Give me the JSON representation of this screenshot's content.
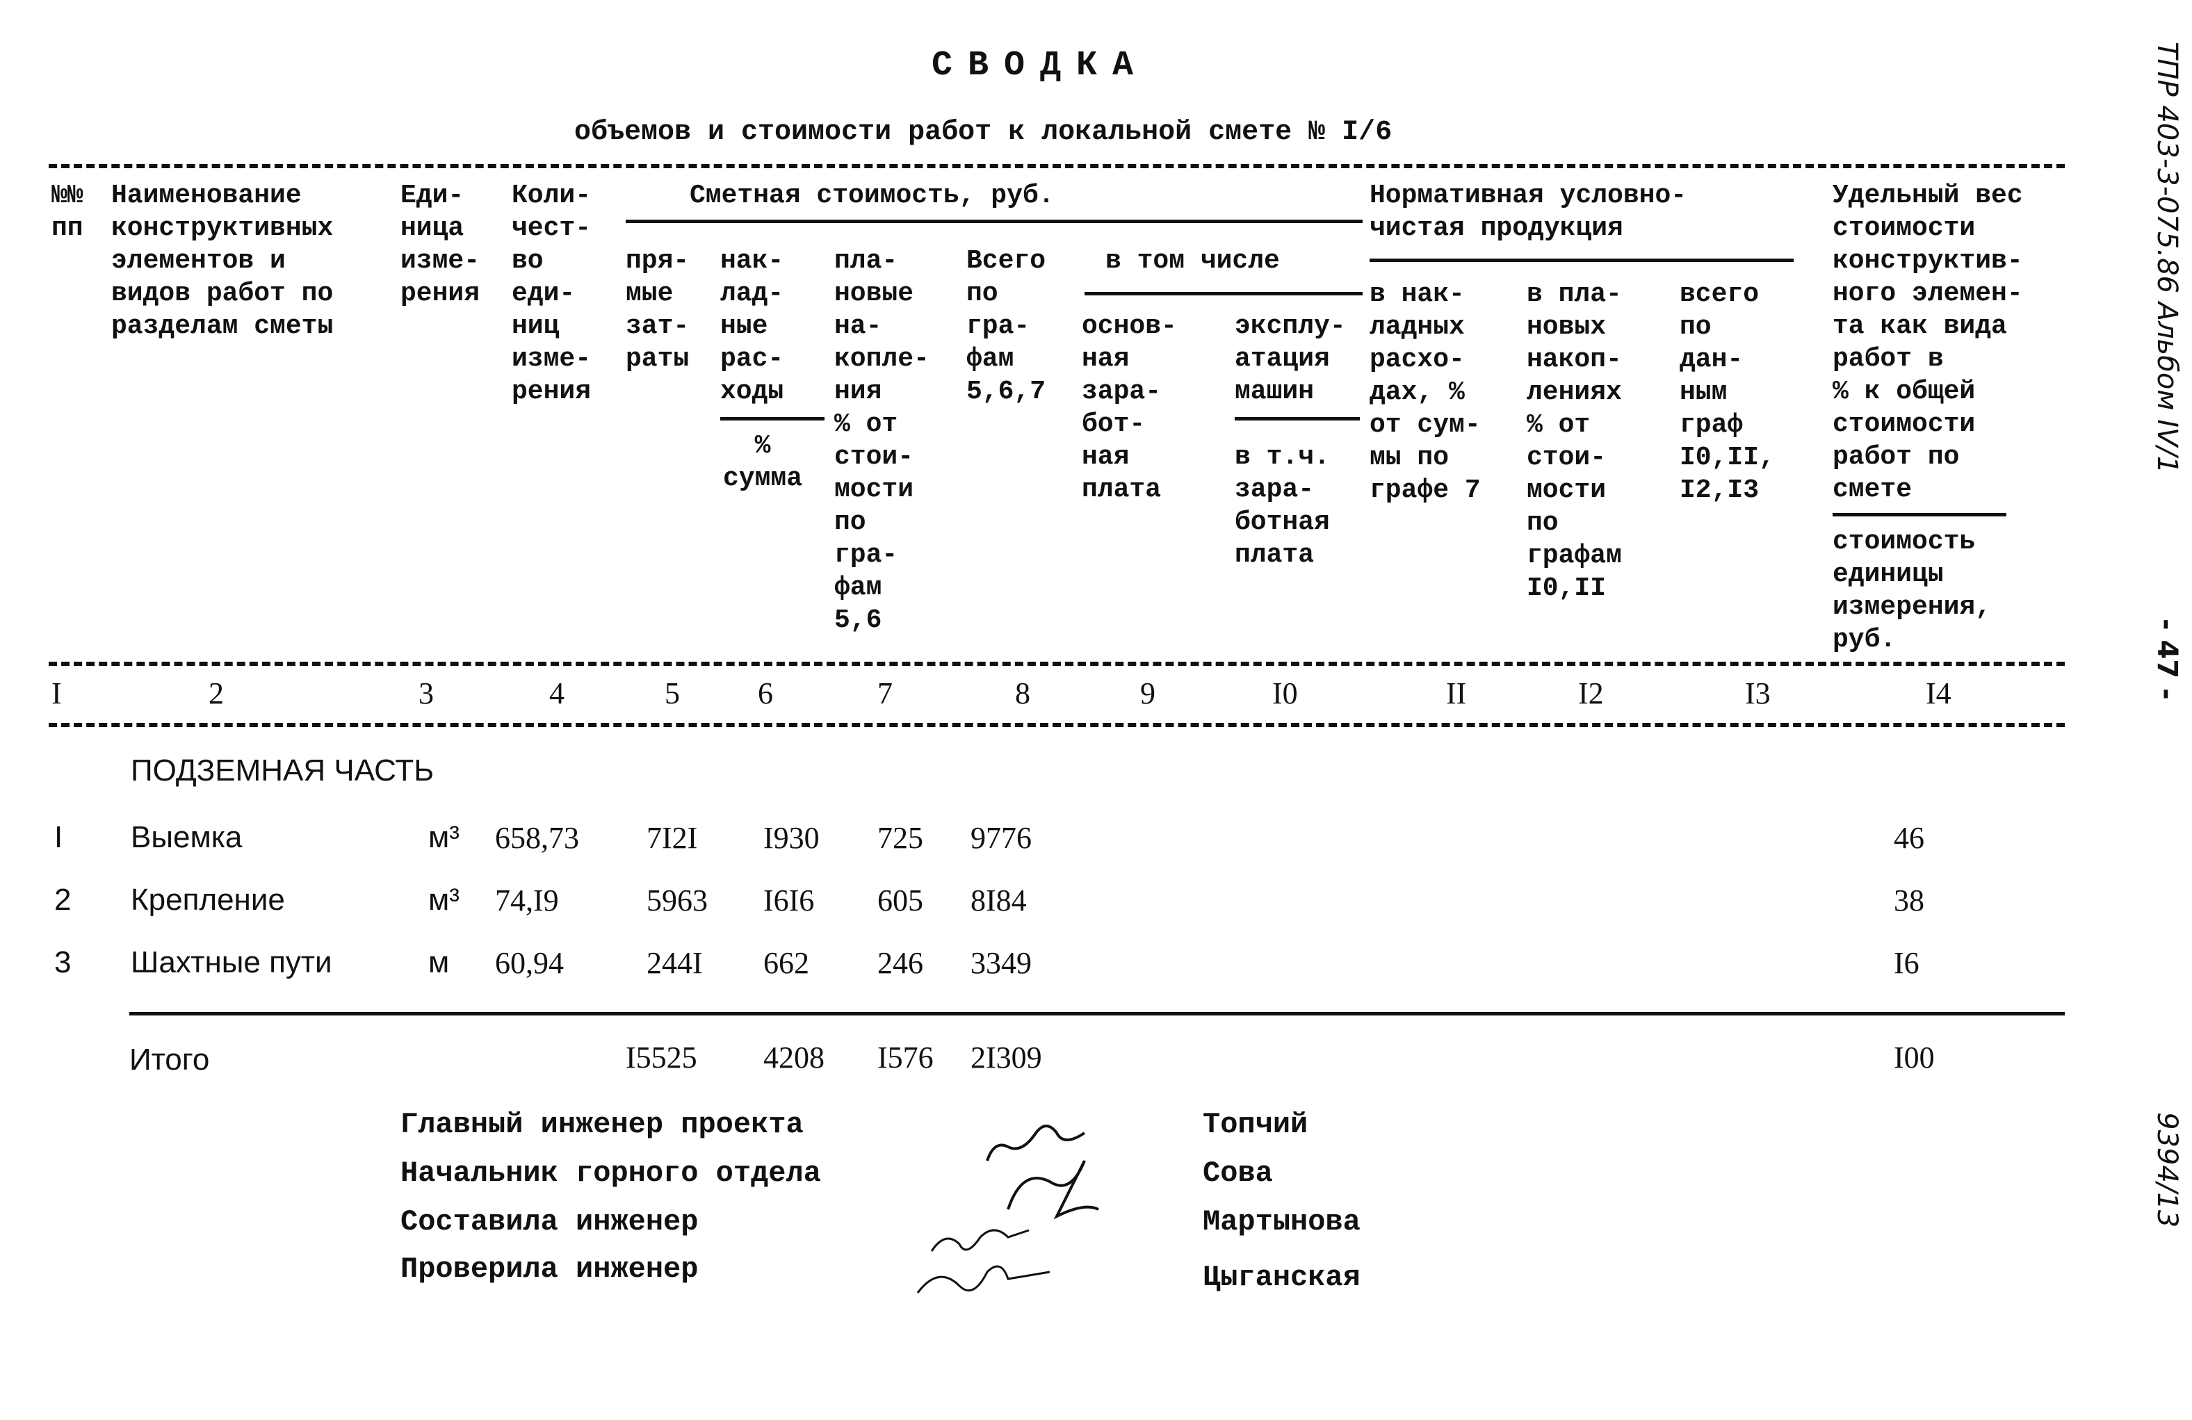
{
  "document": {
    "title": "СВОДКА",
    "subtitle": "объемов и стоимости работ к локальной смете № I/6",
    "margin_code": "ТПР 403-3-075.86 Альбом IV/1",
    "page_number": "- 47 -",
    "archive_number": "9394/13"
  },
  "table": {
    "headers": {
      "col1": "№№\nпп",
      "col2": "Наименование\nконструктивных\nэлементов и\nвидов работ по\nразделам сметы",
      "col3": "Еди-\nница\nизме-\nрения",
      "col4": "Коли-\nчест-\nво\nеди-\nниц\nизме-\nрения",
      "group_cost": "Сметная стоимость, руб.",
      "col5": "пря-\nмые\nзат-\nраты",
      "col6_top": "нак-\nлад-\nные\nрас-\nходы",
      "col6_bottom": "%\nсумма",
      "col7": "пла-\nновые\nна-\nкопле-\nния\n% от\nстои-\nмости\nпо\nгра-\nфам\n5,6",
      "col8": "Всего\nпо\nгра-\nфам\n5,6,7",
      "group_incl": "в том числе",
      "col9": "основ-\nная\nзара-\nбот-\nная\nплата",
      "col10_top": "эксплу-\nатация\nмашин",
      "col10_bottom": "в т.ч.\nзара-\nботная\nплата",
      "group_norm": "Нормативная условно-\nчистая продукция",
      "col11": "в нак-\nладных\nрасхо-\nдах, %\nот сум-\nмы по\nграфе 7",
      "col12": "в пла-\nновых\nнакоп-\nлениях\n% от\nстои-\nмости\nпо\nграфам\nI0,II",
      "col13": "всего\nпо\nдан-\nным\nграф\nI0,II,\nI2,I3",
      "col14_top": "Удельный вес\nстоимости\nконструктив-\nного элемен-\nта как вида\nработ в\n% к общей\nстоимости\nработ по\nсмете",
      "col14_bottom": "стоимость\nединицы\nизмерения,\nруб."
    },
    "column_numbers": [
      "I",
      "2",
      "3",
      "4",
      "5",
      "6",
      "7",
      "8",
      "9",
      "I0",
      "II",
      "I2",
      "I3",
      "I4"
    ],
    "section_title": "ПОДЗЕМНАЯ ЧАСТЬ",
    "rows": [
      {
        "no": "I",
        "name": "Выемка",
        "unit": "м³",
        "qty": "658,73",
        "direct": "7I2I",
        "overhead": "I930",
        "planned": "725",
        "total": "9776",
        "share": "46"
      },
      {
        "no": "2",
        "name": "Крепление",
        "unit": "м³",
        "qty": "74,I9",
        "direct": "5963",
        "overhead": "I6I6",
        "planned": "605",
        "total": "8I84",
        "share": "38"
      },
      {
        "no": "3",
        "name": "Шахтные пути",
        "unit": "м",
        "qty": "60,94",
        "direct": "244I",
        "overhead": "662",
        "planned": "246",
        "total": "3349",
        "share": "I6"
      }
    ],
    "totals": {
      "label": "Итого",
      "direct": "I5525",
      "overhead": "4208",
      "planned": "I576",
      "total": "2I309",
      "share": "I00"
    }
  },
  "signatures": [
    {
      "role": "Главный инженер проекта",
      "name": "Топчий"
    },
    {
      "role": "Начальник горного отдела",
      "name": "Сова"
    },
    {
      "role": "Составила инженер",
      "name": "Мартынова"
    },
    {
      "role": "Проверила инженер",
      "name": "Цыганская"
    }
  ]
}
